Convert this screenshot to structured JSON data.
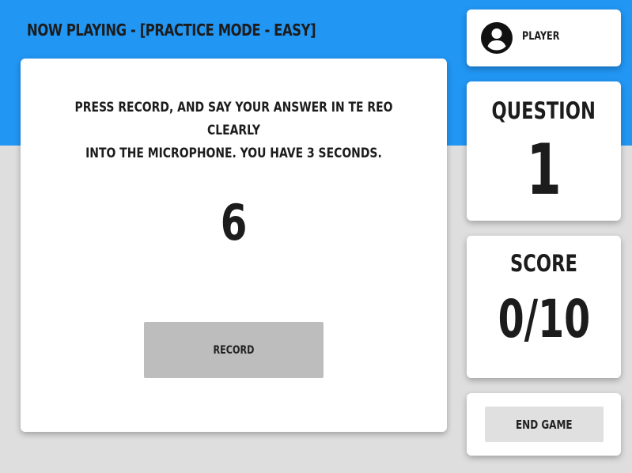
{
  "header": {
    "title": "NOW PLAYING - [PRACTICE MODE - EASY]"
  },
  "prompt": {
    "line1": "PRESS RECORD, AND SAY YOUR ANSWER IN TE REO CLEARLY",
    "line2": "INTO THE MICROPHONE. YOU HAVE 3 SECONDS.",
    "number": "6"
  },
  "record_button": {
    "label": "RECORD"
  },
  "player": {
    "label": "PLAYER",
    "icon": "account-circle-icon"
  },
  "question": {
    "label": "QUESTION",
    "value": "1"
  },
  "score": {
    "label": "SCORE",
    "value": "0/10"
  },
  "end_button": {
    "label": "END GAME"
  },
  "colors": {
    "header_band": "#2196f3",
    "background": "#dedede",
    "card": "#ffffff",
    "record_button": "#bdbdbd",
    "end_button": "#e0e0e0",
    "text": "#1c1c1c"
  }
}
